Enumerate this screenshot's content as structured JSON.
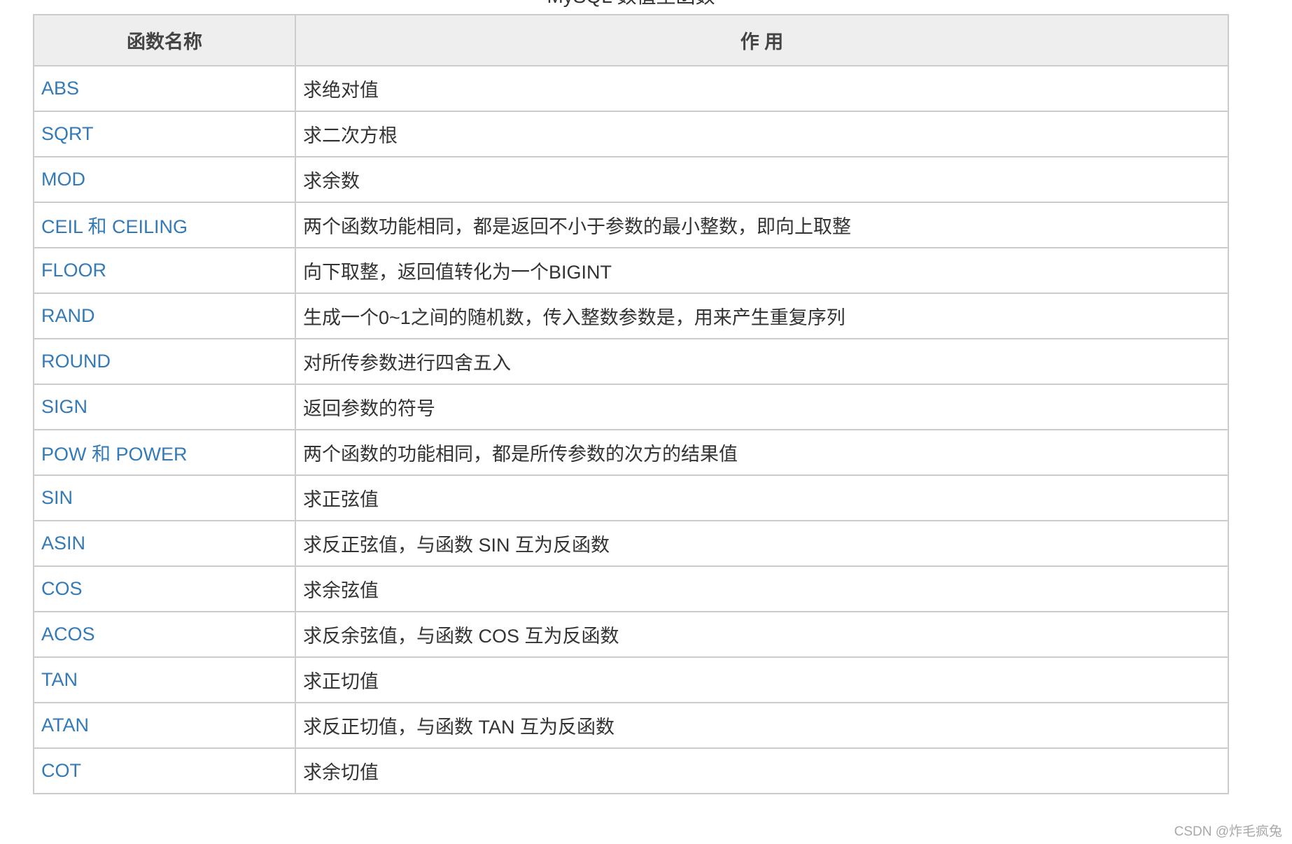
{
  "caption": "MySQL 数值型函数",
  "table": {
    "headers": [
      "函数名称",
      "作 用"
    ],
    "rows": [
      {
        "name": "ABS",
        "desc": "求绝对值"
      },
      {
        "name": "SQRT",
        "desc": "求二次方根"
      },
      {
        "name": "MOD",
        "desc": "求余数"
      },
      {
        "name": "CEIL 和 CEILING",
        "desc": "两个函数功能相同，都是返回不小于参数的最小整数，即向上取整"
      },
      {
        "name": "FLOOR",
        "desc": "向下取整，返回值转化为一个BIGINT"
      },
      {
        "name": "RAND",
        "desc": "生成一个0~1之间的随机数，传入整数参数是，用来产生重复序列"
      },
      {
        "name": "ROUND",
        "desc": "对所传参数进行四舍五入"
      },
      {
        "name": "SIGN",
        "desc": "返回参数的符号"
      },
      {
        "name": "POW 和 POWER",
        "desc": "两个函数的功能相同，都是所传参数的次方的结果值"
      },
      {
        "name": "SIN",
        "desc": "求正弦值"
      },
      {
        "name": "ASIN",
        "desc": "求反正弦值，与函数 SIN 互为反函数"
      },
      {
        "name": "COS",
        "desc": "求余弦值"
      },
      {
        "name": "ACOS",
        "desc": "求反余弦值，与函数 COS 互为反函数"
      },
      {
        "name": "TAN",
        "desc": "求正切值"
      },
      {
        "name": "ATAN",
        "desc": "求反正切值，与函数 TAN 互为反函数"
      },
      {
        "name": "COT",
        "desc": "求余切值"
      }
    ]
  },
  "watermark": "CSDN @炸毛疯兔",
  "colors": {
    "link": "#337ab7",
    "text": "#333333",
    "header_bg": "#eeeeee",
    "border": "#cccccc"
  }
}
